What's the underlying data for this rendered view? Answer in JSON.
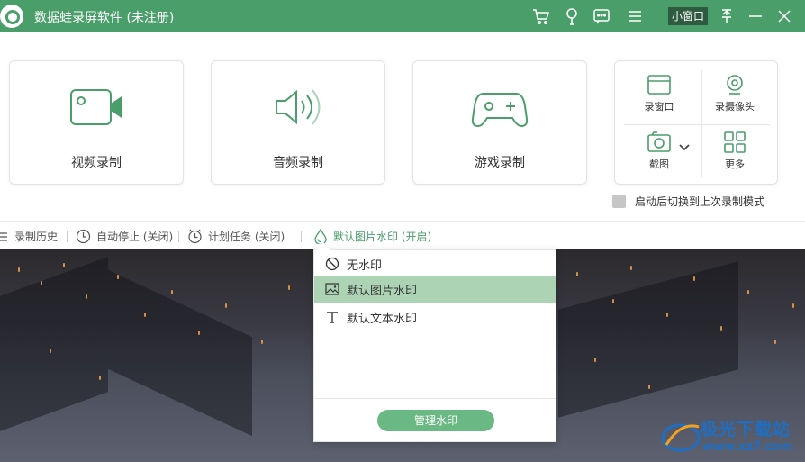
{
  "title_bar": {
    "app_title": "数据蛙录屏软件 (未注册)",
    "mini_window_label": "小窗口",
    "icons": [
      "cart-icon",
      "bulb-icon",
      "chat-icon",
      "menu-icon",
      "pin-icon",
      "minimize-icon",
      "close-icon"
    ]
  },
  "main_cards": [
    {
      "label": "视频录制",
      "icon": "video-camera-icon"
    },
    {
      "label": "音频录制",
      "icon": "speaker-icon"
    },
    {
      "label": "游戏录制",
      "icon": "gamepad-icon"
    }
  ],
  "tools": {
    "record_window": "录窗口",
    "record_camera": "录摄像头",
    "screenshot": "截图",
    "more": "更多"
  },
  "auto_switch_label": "启动后切换到上次录制模式",
  "toolbar": {
    "history": "录制历史",
    "auto_stop": "自动停止 (关闭)",
    "schedule": "计划任务 (关闭)",
    "watermark": "默认图片水印 (开启)"
  },
  "watermark_menu": {
    "options": [
      "无水印",
      "默认图片水印",
      "默认文本水印"
    ],
    "selected": "默认图片水印",
    "manage_button": "管理水印"
  },
  "branding": {
    "name": "极光下载站",
    "url": "www.xz7.com"
  },
  "colors": {
    "accent": "#4a9e6a",
    "selected_option": "#acd3b4",
    "manage_button": "#6ab985"
  }
}
